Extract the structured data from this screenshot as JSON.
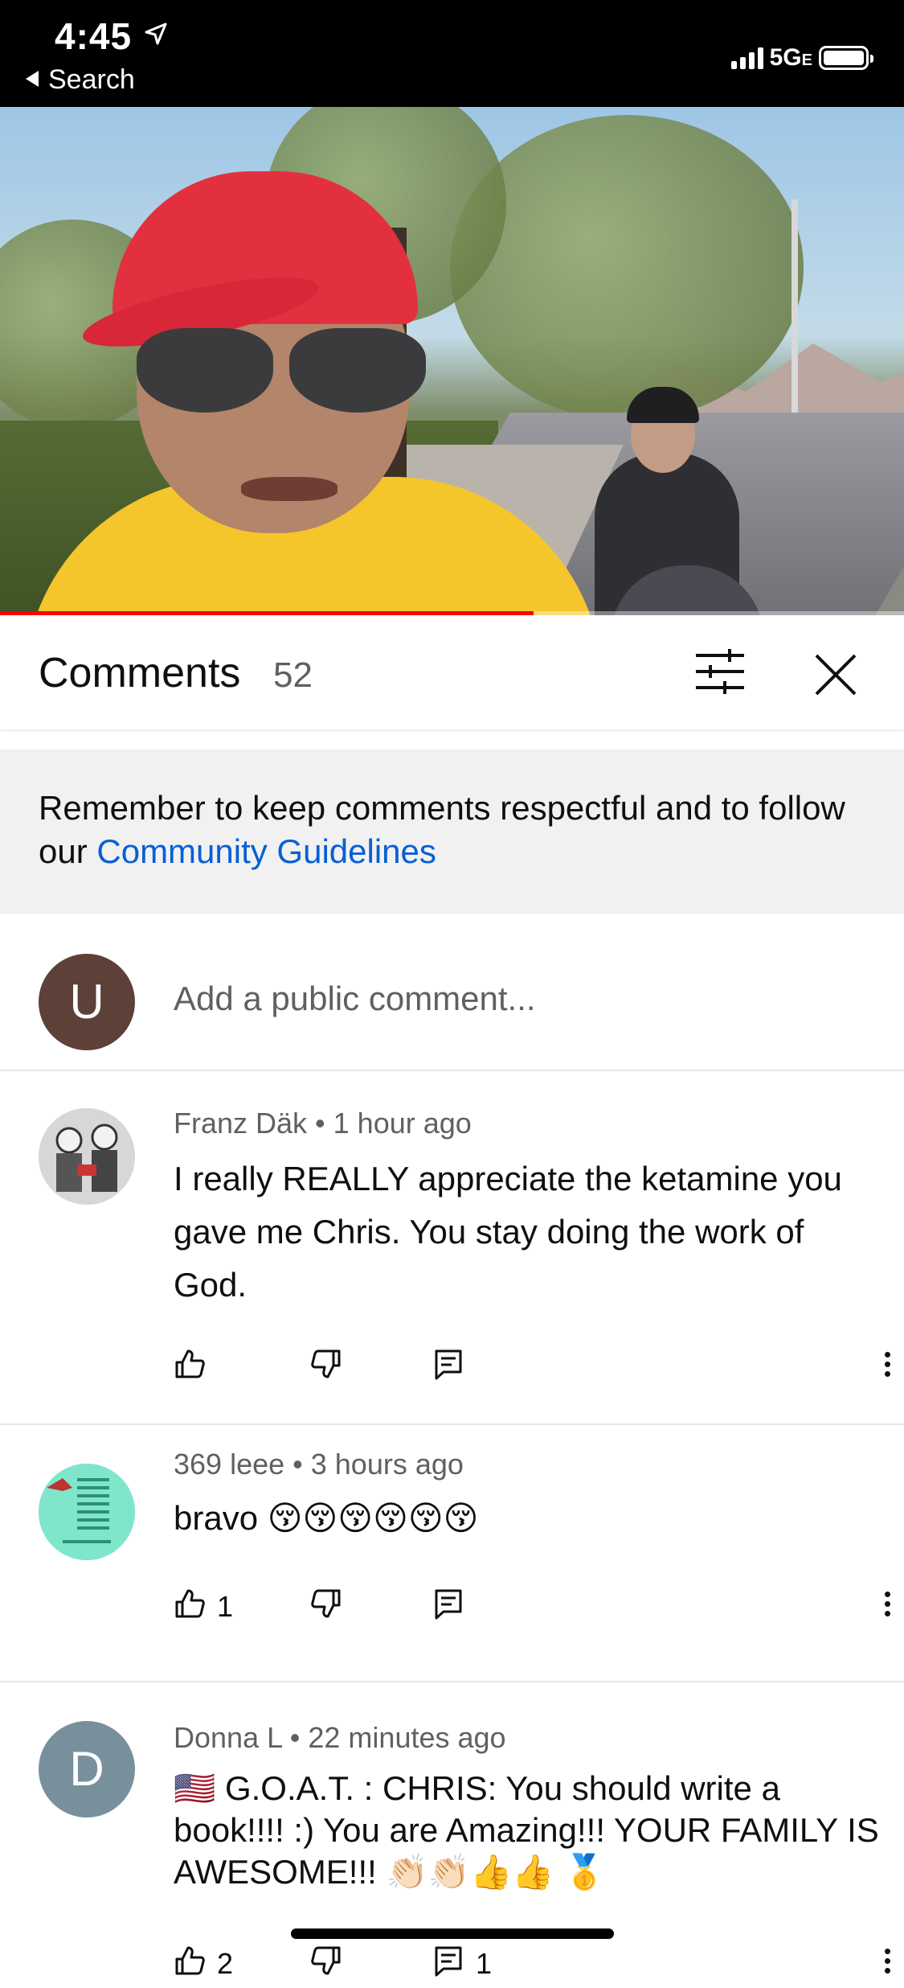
{
  "status_bar": {
    "time": "4:45",
    "back_label": "Search",
    "network": "5G",
    "network_suffix": "E"
  },
  "comments_header": {
    "title": "Comments",
    "count": "52"
  },
  "notice": {
    "text": "Remember to keep comments respectful and to follow our ",
    "link": "Community Guidelines"
  },
  "add_comment": {
    "avatar_letter": "U",
    "placeholder": "Add a public comment..."
  },
  "comments": [
    {
      "author": "Franz Däk",
      "time": "1 hour ago",
      "text": "I really REALLY appreciate the ketamine you gave me Chris. You stay doing the work of God.",
      "likes": "",
      "replies": ""
    },
    {
      "author": "369 leee",
      "time": "3 hours ago",
      "text": "bravo 😚😚😚😚😚😚",
      "likes": "1",
      "replies": ""
    },
    {
      "author": "Donna L",
      "avatar_letter": "D",
      "time": "22 minutes ago",
      "text": "🇺🇸  G.O.A.T. :      CHRIS: You should write a book!!!! :)    You are Amazing!!!  YOUR FAMILY IS AWESOME!!! 👏🏻👏🏻👍👍 🥇",
      "likes": "2",
      "replies": "1"
    }
  ],
  "colors": {
    "accent_link": "#065fd4",
    "progress": "#ff0000",
    "avatar_user": "#5d4037",
    "avatar_donna": "#78909c"
  },
  "video": {
    "progress": 0.59
  }
}
